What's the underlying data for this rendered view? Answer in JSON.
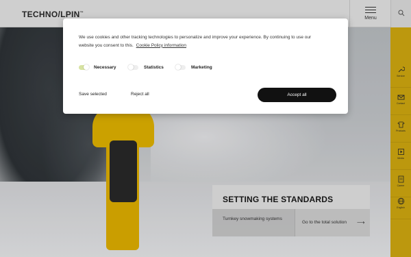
{
  "header": {
    "logo_text": "TECHNO",
    "logo_slash": "/",
    "logo_text2": "LPIN",
    "logo_tm": "™",
    "menu_label": "Menu"
  },
  "sidebar": {
    "items": [
      {
        "label": "Service",
        "icon": "wrench-icon"
      },
      {
        "label": "Contact",
        "icon": "mail-icon"
      },
      {
        "label": "Products",
        "icon": "shirt-icon"
      },
      {
        "label": "Media",
        "icon": "media-icon"
      },
      {
        "label": "Career",
        "icon": "document-icon"
      },
      {
        "label": "English",
        "icon": "globe-icon"
      }
    ]
  },
  "cookie": {
    "message": "We use cookies and other tracking technologies to personalize and improve your experience. By continuing to use our website you consent to this.",
    "policy_link": "Cookie Policy information",
    "toggles": [
      {
        "label": "Necessary",
        "state": "on"
      },
      {
        "label": "Statistics",
        "state": "off"
      },
      {
        "label": "Marketing",
        "state": "off"
      }
    ],
    "save_label": "Save selected",
    "reject_label": "Reject all",
    "accept_label": "Accept all"
  },
  "hero": {
    "title": "SETTING THE STANDARDS",
    "subtitle": "Turnkey snowmaking systems",
    "link_label": "Go to the total solution",
    "arrow": "⟶"
  },
  "colors": {
    "accent_yellow": "#d6ad10",
    "accept_button": "#111111",
    "toggle_on": "#d7e3a2"
  }
}
